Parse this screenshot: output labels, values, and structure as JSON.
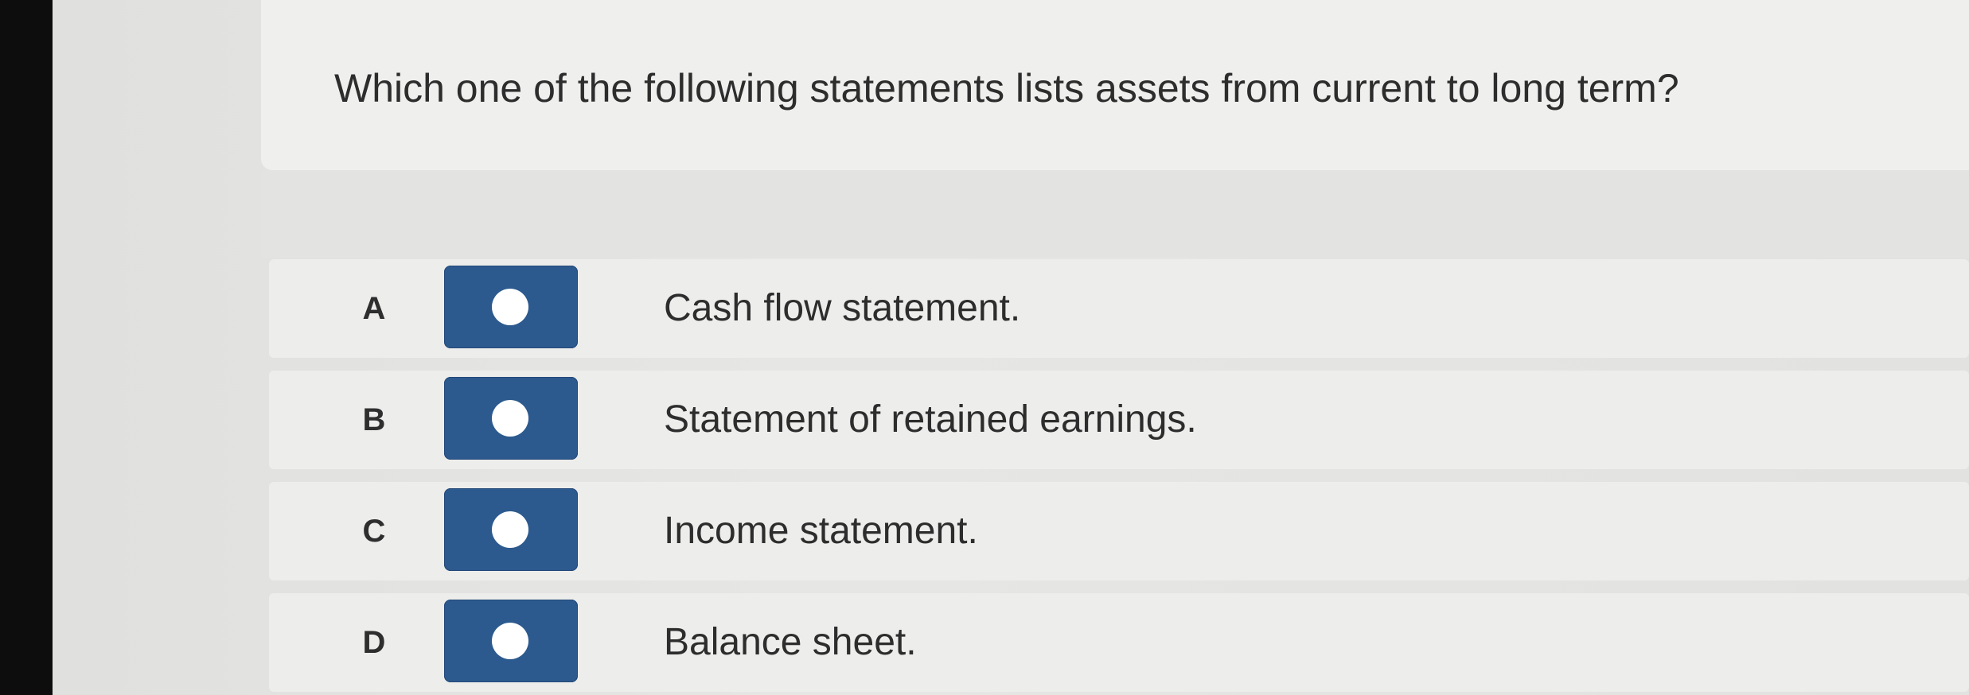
{
  "question": {
    "text": "Which one of the following statements lists assets from current to long term?"
  },
  "options": [
    {
      "letter": "A",
      "text": "Cash flow statement."
    },
    {
      "letter": "B",
      "text": "Statement of retained earnings."
    },
    {
      "letter": "C",
      "text": "Income statement."
    },
    {
      "letter": "D",
      "text": "Balance sheet."
    }
  ],
  "colors": {
    "radio_button": "#2c5a8e",
    "radio_dot": "#ffffff",
    "text": "#2d2d2d"
  }
}
